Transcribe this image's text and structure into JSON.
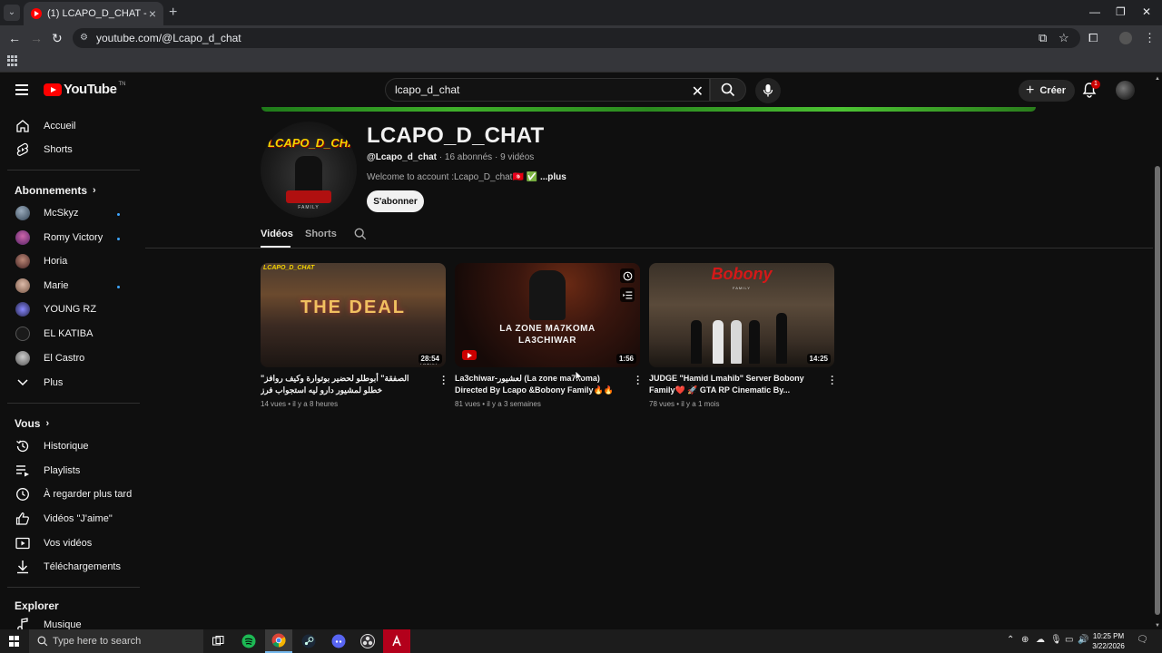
{
  "browser": {
    "tab_title": "(1) LCAPO_D_CHAT - YouTube",
    "url": "youtube.com/@Lcapo_d_chat"
  },
  "masthead": {
    "logo_text": "YouTube",
    "logo_country": "TN",
    "search_value": "lcapo_d_chat",
    "create_label": "Créer",
    "notification_count": "1"
  },
  "sidebar": {
    "main": [
      {
        "label": "Accueil",
        "icon": "home-icon"
      },
      {
        "label": "Shorts",
        "icon": "shorts-icon"
      }
    ],
    "subscriptions_header": "Abonnements",
    "subscriptions": [
      {
        "label": "McSkyz",
        "new": true
      },
      {
        "label": "Romy Victory",
        "new": true
      },
      {
        "label": "Horia",
        "new": false
      },
      {
        "label": "Marie",
        "new": true
      },
      {
        "label": "YOUNG RZ",
        "new": false
      },
      {
        "label": "EL KATIBA",
        "new": false
      },
      {
        "label": "El Castro",
        "new": false
      }
    ],
    "more_label": "Plus",
    "you_header": "Vous",
    "you_items": [
      {
        "label": "Historique",
        "icon": "history-icon"
      },
      {
        "label": "Playlists",
        "icon": "playlists-icon"
      },
      {
        "label": "À regarder plus tard",
        "icon": "watch-later-icon"
      },
      {
        "label": "Vidéos \"J'aime\"",
        "icon": "like-icon"
      },
      {
        "label": "Vos vidéos",
        "icon": "your-videos-icon"
      },
      {
        "label": "Téléchargements",
        "icon": "download-icon"
      }
    ],
    "explore_header": "Explorer",
    "explore_items": [
      {
        "label": "Musique",
        "icon": "music-icon"
      }
    ]
  },
  "channel": {
    "name": "LCAPO_D_CHAT",
    "handle": "@Lcapo_d_chat",
    "subscribers": "16 abonnés",
    "videos_count": "9 vidéos",
    "description": "Welcome to account :Lcapo_D_chat🇹🇳 ✅",
    "more_label": "...plus",
    "subscribe_label": "S'abonner",
    "avatar_text": "LCAPO_D_CHAT",
    "avatar_sub": "FAMILY",
    "tabs": [
      "Vidéos",
      "Shorts"
    ]
  },
  "videos": [
    {
      "title": "\"الصفقة\" أبوطلو لحضير بوتوارة وكيف روافز خطلو لمشيور دارو ليه استجواب فرز انه..._Server bobony Family",
      "views": "14 vues",
      "age": "il y a 8 heures",
      "duration": "28:54",
      "thumb_label": "LCAPO_D_CHAT",
      "thumb_big": "THE DEAL",
      "thumb_sub": "FAMILY"
    },
    {
      "title": "La3chiwar-لعشيور (La zone ma7koma) Directed By Lcapo &Bobony Family🔥🔥🎬 ...",
      "views": "81 vues",
      "age": "il y a 3 semaines",
      "duration": "1:56",
      "thumb_line1": "LA ZONE MA7KOMA",
      "thumb_line2": "LA3CHIWAR"
    },
    {
      "title": "JUDGE \"Hamid Lmahib\" Server Bobony Family❤️ 🚀 GTA RP Cinematic By...",
      "views": "78 vues",
      "age": "il y a 1 mois",
      "duration": "14:25",
      "thumb_brand": "Bobony",
      "thumb_brand_sub": "FAMILY"
    }
  ],
  "taskbar": {
    "search_placeholder": "Type here to search",
    "time": "10:25 PM",
    "date": "3/22/2026"
  },
  "colors": {
    "background": "#0f0f0f",
    "accent_red": "#ff0000",
    "badge_blue": "#3ea6ff",
    "banner_green": "#3fb02a"
  }
}
